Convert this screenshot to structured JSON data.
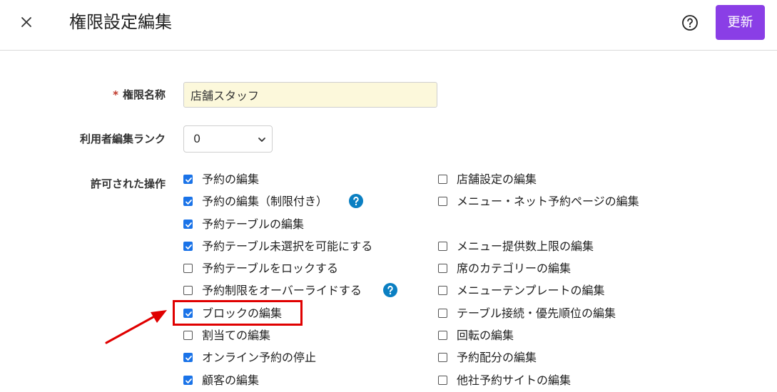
{
  "header": {
    "title": "権限設定編集",
    "update_label": "更新"
  },
  "form": {
    "name_label": "権限名称",
    "required_mark": "*",
    "name_value": "店舗スタッフ",
    "rank_label": "利用者編集ランク",
    "rank_value": "0",
    "permissions_label": "許可された操作"
  },
  "permissions": {
    "left": [
      {
        "label": "予約の編集",
        "checked": true
      },
      {
        "label": "予約の編集（制限付き）",
        "checked": true,
        "info": true
      },
      {
        "label": "予約テーブルの編集",
        "checked": true
      },
      {
        "label": "予約テーブル未選択を可能にする",
        "checked": true
      },
      {
        "label": "予約テーブルをロックする",
        "checked": false
      },
      {
        "label": "予約制限をオーバーライドする",
        "checked": false,
        "info": true
      },
      {
        "label": "ブロックの編集",
        "checked": true,
        "highlighted": true
      },
      {
        "label": "割当ての編集",
        "checked": false
      },
      {
        "label": "オンライン予約の停止",
        "checked": true
      },
      {
        "label": "顧客の編集",
        "checked": true
      }
    ],
    "right": [
      {
        "label": "店舗設定の編集",
        "checked": false
      },
      {
        "label": "メニュー・ネット予約ページの編集",
        "checked": false
      },
      {
        "label": "メニュー提供数上限の編集",
        "checked": false
      },
      {
        "label": "席のカテゴリーの編集",
        "checked": false
      },
      {
        "label": "メニューテンプレートの編集",
        "checked": false
      },
      {
        "label": "テーブル接続・優先順位の編集",
        "checked": false
      },
      {
        "label": "回転の編集",
        "checked": false
      },
      {
        "label": "予約配分の編集",
        "checked": false
      },
      {
        "label": "他社予約サイトの編集",
        "checked": false
      }
    ]
  },
  "colors": {
    "accent": "#8a3ee6",
    "checkbox": "#1a73e8",
    "info": "#0a7fc2",
    "highlight": "#e00000",
    "input_bg": "#fcf8db"
  },
  "icons": {
    "close": "close-icon",
    "help": "help-circle-icon",
    "info": "info-question-icon",
    "chevron": "chevron-down-icon",
    "arrow": "arrow-icon"
  }
}
